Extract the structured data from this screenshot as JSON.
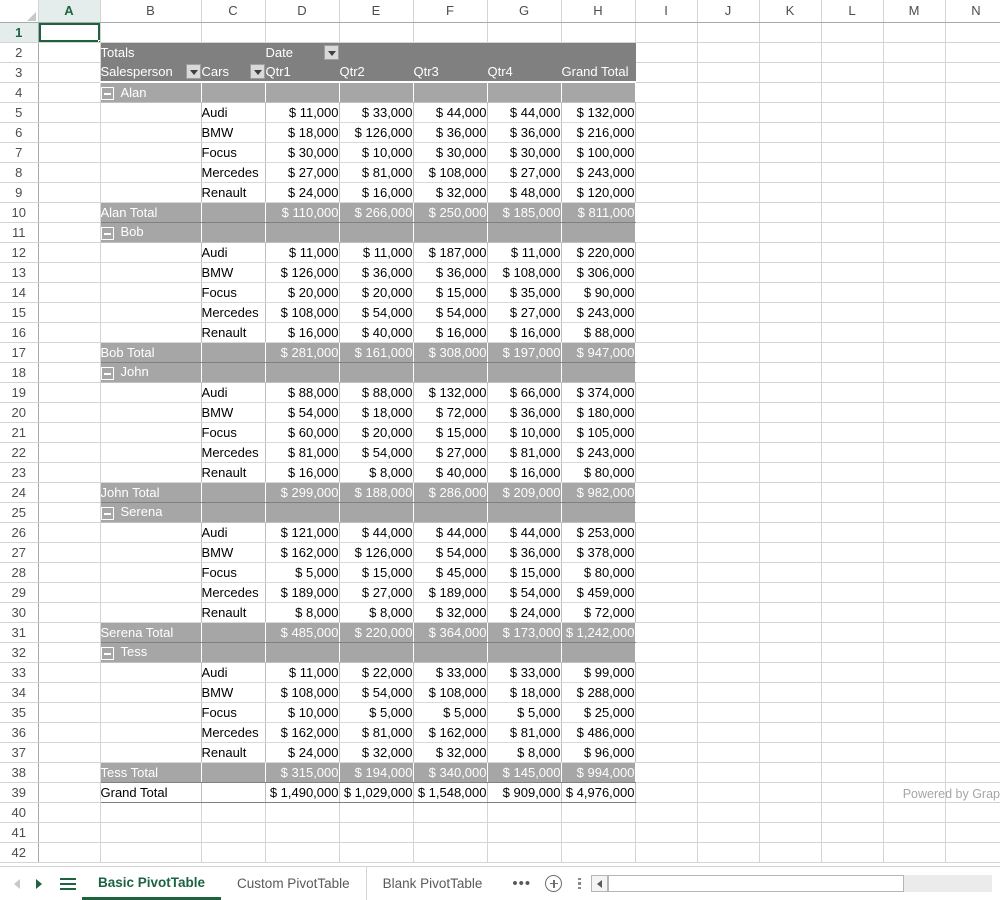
{
  "app": {
    "selected_cell": "A1",
    "watermark": "Powered by Grap"
  },
  "grid": {
    "column_letters": [
      "A",
      "B",
      "C",
      "D",
      "E",
      "F",
      "G",
      "H",
      "I",
      "J",
      "K",
      "L",
      "M",
      "N"
    ],
    "row_numbers": [
      "1",
      "2",
      "3",
      "4",
      "5",
      "6",
      "7",
      "8",
      "9",
      "10",
      "11",
      "12",
      "13",
      "14",
      "15",
      "16",
      "17",
      "18",
      "19",
      "20",
      "21",
      "22",
      "23",
      "24",
      "25",
      "26",
      "27",
      "28",
      "29",
      "30",
      "31",
      "32",
      "33",
      "34",
      "35",
      "36",
      "37",
      "38",
      "39",
      "40",
      "41",
      "42"
    ]
  },
  "pivot": {
    "title": "Totals",
    "date_label": "Date",
    "field_salesperson": "Salesperson",
    "field_cars": "Cars",
    "columns": [
      "Qtr1",
      "Qtr2",
      "Qtr3",
      "Qtr4",
      "Grand Total"
    ],
    "grand_total_label": "Grand Total",
    "groups": [
      {
        "name": "Alan",
        "total_label": "Alan Total",
        "rows": [
          {
            "car": "Audi",
            "values": [
              "$ 11,000",
              "$ 33,000",
              "$ 44,000",
              "$ 44,000",
              "$ 132,000"
            ]
          },
          {
            "car": "BMW",
            "values": [
              "$ 18,000",
              "$ 126,000",
              "$ 36,000",
              "$ 36,000",
              "$ 216,000"
            ]
          },
          {
            "car": "Focus",
            "values": [
              "$ 30,000",
              "$ 10,000",
              "$ 30,000",
              "$ 30,000",
              "$ 100,000"
            ]
          },
          {
            "car": "Mercedes",
            "values": [
              "$ 27,000",
              "$ 81,000",
              "$ 108,000",
              "$ 27,000",
              "$ 243,000"
            ]
          },
          {
            "car": "Renault",
            "values": [
              "$ 24,000",
              "$ 16,000",
              "$ 32,000",
              "$ 48,000",
              "$ 120,000"
            ]
          }
        ],
        "totals": [
          "$ 110,000",
          "$ 266,000",
          "$ 250,000",
          "$ 185,000",
          "$ 811,000"
        ]
      },
      {
        "name": "Bob",
        "total_label": "Bob Total",
        "rows": [
          {
            "car": "Audi",
            "values": [
              "$ 11,000",
              "$ 11,000",
              "$ 187,000",
              "$ 11,000",
              "$ 220,000"
            ]
          },
          {
            "car": "BMW",
            "values": [
              "$ 126,000",
              "$ 36,000",
              "$ 36,000",
              "$ 108,000",
              "$ 306,000"
            ]
          },
          {
            "car": "Focus",
            "values": [
              "$ 20,000",
              "$ 20,000",
              "$ 15,000",
              "$ 35,000",
              "$ 90,000"
            ]
          },
          {
            "car": "Mercedes",
            "values": [
              "$ 108,000",
              "$ 54,000",
              "$ 54,000",
              "$ 27,000",
              "$ 243,000"
            ]
          },
          {
            "car": "Renault",
            "values": [
              "$ 16,000",
              "$ 40,000",
              "$ 16,000",
              "$ 16,000",
              "$ 88,000"
            ]
          }
        ],
        "totals": [
          "$ 281,000",
          "$ 161,000",
          "$ 308,000",
          "$ 197,000",
          "$ 947,000"
        ]
      },
      {
        "name": "John",
        "total_label": "John Total",
        "rows": [
          {
            "car": "Audi",
            "values": [
              "$ 88,000",
              "$ 88,000",
              "$ 132,000",
              "$ 66,000",
              "$ 374,000"
            ]
          },
          {
            "car": "BMW",
            "values": [
              "$ 54,000",
              "$ 18,000",
              "$ 72,000",
              "$ 36,000",
              "$ 180,000"
            ]
          },
          {
            "car": "Focus",
            "values": [
              "$ 60,000",
              "$ 20,000",
              "$ 15,000",
              "$ 10,000",
              "$ 105,000"
            ]
          },
          {
            "car": "Mercedes",
            "values": [
              "$ 81,000",
              "$ 54,000",
              "$ 27,000",
              "$ 81,000",
              "$ 243,000"
            ]
          },
          {
            "car": "Renault",
            "values": [
              "$ 16,000",
              "$ 8,000",
              "$ 40,000",
              "$ 16,000",
              "$ 80,000"
            ]
          }
        ],
        "totals": [
          "$ 299,000",
          "$ 188,000",
          "$ 286,000",
          "$ 209,000",
          "$ 982,000"
        ]
      },
      {
        "name": "Serena",
        "total_label": "Serena Total",
        "rows": [
          {
            "car": "Audi",
            "values": [
              "$ 121,000",
              "$ 44,000",
              "$ 44,000",
              "$ 44,000",
              "$ 253,000"
            ]
          },
          {
            "car": "BMW",
            "values": [
              "$ 162,000",
              "$ 126,000",
              "$ 54,000",
              "$ 36,000",
              "$ 378,000"
            ]
          },
          {
            "car": "Focus",
            "values": [
              "$ 5,000",
              "$ 15,000",
              "$ 45,000",
              "$ 15,000",
              "$ 80,000"
            ]
          },
          {
            "car": "Mercedes",
            "values": [
              "$ 189,000",
              "$ 27,000",
              "$ 189,000",
              "$ 54,000",
              "$ 459,000"
            ]
          },
          {
            "car": "Renault",
            "values": [
              "$ 8,000",
              "$ 8,000",
              "$ 32,000",
              "$ 24,000",
              "$ 72,000"
            ]
          }
        ],
        "totals": [
          "$ 485,000",
          "$ 220,000",
          "$ 364,000",
          "$ 173,000",
          "$ 1,242,000"
        ]
      },
      {
        "name": "Tess",
        "total_label": "Tess Total",
        "rows": [
          {
            "car": "Audi",
            "values": [
              "$ 11,000",
              "$ 22,000",
              "$ 33,000",
              "$ 33,000",
              "$ 99,000"
            ]
          },
          {
            "car": "BMW",
            "values": [
              "$ 108,000",
              "$ 54,000",
              "$ 108,000",
              "$ 18,000",
              "$ 288,000"
            ]
          },
          {
            "car": "Focus",
            "values": [
              "$ 10,000",
              "$ 5,000",
              "$ 5,000",
              "$ 5,000",
              "$ 25,000"
            ]
          },
          {
            "car": "Mercedes",
            "values": [
              "$ 162,000",
              "$ 81,000",
              "$ 162,000",
              "$ 81,000",
              "$ 486,000"
            ]
          },
          {
            "car": "Renault",
            "values": [
              "$ 24,000",
              "$ 32,000",
              "$ 32,000",
              "$ 8,000",
              "$ 96,000"
            ]
          }
        ],
        "totals": [
          "$ 315,000",
          "$ 194,000",
          "$ 340,000",
          "$ 145,000",
          "$ 994,000"
        ]
      }
    ],
    "grand_totals": [
      "$ 1,490,000",
      "$ 1,029,000",
      "$ 1,548,000",
      "$ 909,000",
      "$ 4,976,000"
    ]
  },
  "sheet_tabs": {
    "tabs": [
      {
        "label": "Basic PivotTable",
        "active": true
      },
      {
        "label": "Custom PivotTable",
        "active": false
      },
      {
        "label": "Blank PivotTable",
        "active": false
      }
    ],
    "more_label": "•••"
  }
}
